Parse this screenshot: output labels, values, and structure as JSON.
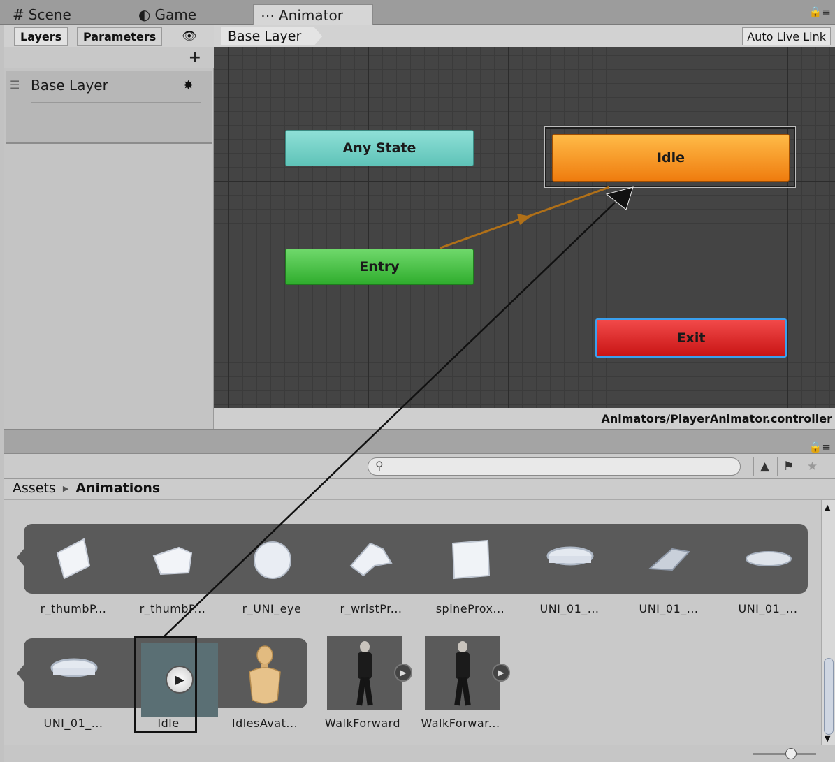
{
  "tabs": [
    {
      "label": "Scene",
      "icon": "#"
    },
    {
      "label": "Game",
      "icon": "C"
    },
    {
      "label": "Animator",
      "icon": "ଳ"
    }
  ],
  "left_panel": {
    "tabs": [
      "Layers",
      "Parameters"
    ],
    "add_symbol": "+",
    "layer_name": "Base Layer",
    "gear_symbol": "✸"
  },
  "graph": {
    "breadcrumb": "Base Layer",
    "auto_live_link": "Auto Live Link",
    "states": {
      "any_state": "Any State",
      "entry": "Entry",
      "idle": "Idle",
      "exit": "Exit"
    },
    "controller_path": "Animators/PlayerAnimator.controller"
  },
  "project": {
    "breadcrumb": [
      "Assets",
      "Animations"
    ],
    "search_placeholder": "",
    "row1": [
      "r_thumbP...",
      "r_thumbP...",
      "r_UNI_eye",
      "r_wristPr...",
      "spineProx...",
      "UNI_01_...",
      "UNI_01_...",
      "UNI_01_..."
    ],
    "row2": [
      "UNI_01_...",
      "Idle",
      "IdlesAvat...",
      "WalkForward",
      "WalkForwar..."
    ]
  },
  "icons": [
    "grid-icon",
    "pacman-icon",
    "animator-icon",
    "lock-icon",
    "eye-icon",
    "plus-icon",
    "gear-icon",
    "search-icon",
    "filter-icon",
    "label-icon",
    "star-icon",
    "play-icon"
  ]
}
